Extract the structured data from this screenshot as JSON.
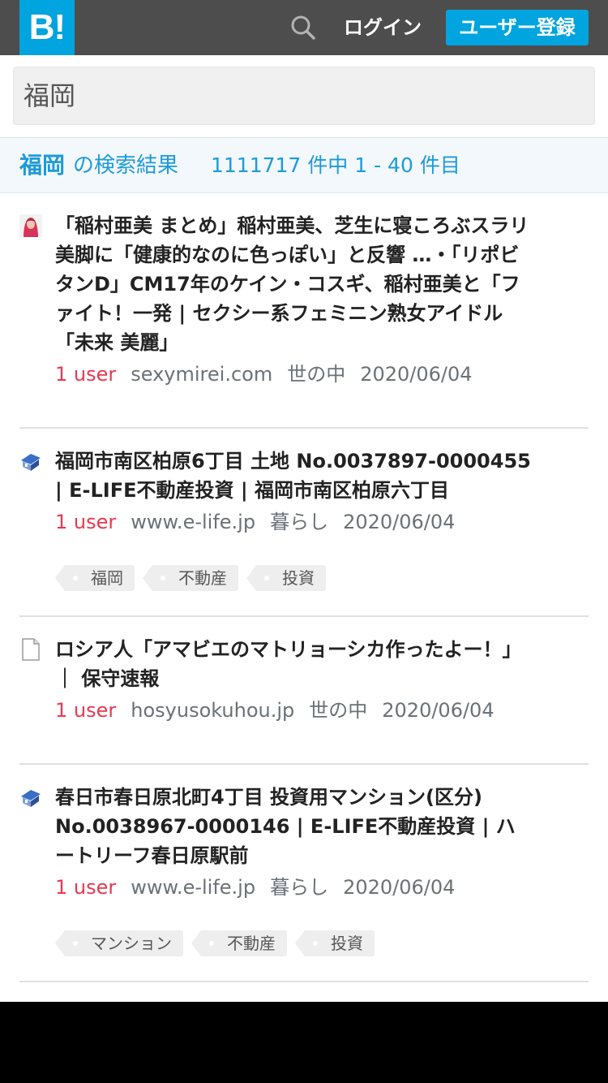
{
  "header": {
    "logo": "B!",
    "login_label": "ログイン",
    "signup_label": "ユーザー登録"
  },
  "search": {
    "value": "福岡"
  },
  "result_bar": {
    "query": "福岡",
    "suffix": "の検索結果",
    "count_text": "1111717 件中 1 - 40 件目"
  },
  "entries": [
    {
      "title": "「稲村亜美 まとめ」稲村亜美、芝生に寝ころぶスラリ美脚に「健康的なのに色っぽい」と反響 …・「リポビタンD」CM17年のケイン・コスギ、稲村亜美と「ファイト！一発 | セクシー系フェミニン熟女アイドル「未来 美麗」",
      "users": "1 user",
      "domain": "sexymirei.com",
      "category": "世の中",
      "date": "2020/06/04",
      "favicon": "portrait-icon",
      "tags": []
    },
    {
      "title": "福岡市南区柏原6丁目 土地 No.0037897-0000455 | E-LIFE不動産投資 | 福岡市南区柏原六丁目",
      "users": "1 user",
      "domain": "www.e-life.jp",
      "category": "暮らし",
      "date": "2020/06/04",
      "favicon": "house-icon",
      "tags": [
        "福岡",
        "不動産",
        "投資"
      ]
    },
    {
      "title": "ロシア人「アマビエのマトリョーシカ作ったよー！」 ｜ 保守速報",
      "users": "1 user",
      "domain": "hosyusokuhou.jp",
      "category": "世の中",
      "date": "2020/06/04",
      "favicon": "document-icon",
      "tags": []
    },
    {
      "title": "春日市春日原北町4丁目 投資用マンション(区分) No.0038967-0000146 | E-LIFE不動産投資 | ハートリーフ春日原駅前",
      "users": "1 user",
      "domain": "www.e-life.jp",
      "category": "暮らし",
      "date": "2020/06/04",
      "favicon": "house-icon",
      "tags": [
        "マンション",
        "不動産",
        "投資"
      ]
    }
  ],
  "colors": {
    "header_bg": "#4d4d4d",
    "brand": "#00a4de",
    "users": "#e8384f",
    "result_text": "#1d9bd7"
  }
}
